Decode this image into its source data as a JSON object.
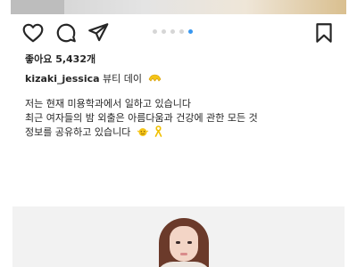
{
  "post": {
    "likes": "좋아요 5,432개",
    "caption_username": "kizaki_jessica",
    "caption_title": "뷰티 데이",
    "caption_lines": [
      "저는 현재 미용학과에서 일하고 있습니다",
      "최근 여자들의 밤 외출은 아름다움과 건강에 관한 모든 것",
      "정보를 공유하고 있습니다"
    ]
  },
  "carousel": {
    "total": 5,
    "active_index": 4
  },
  "icons": {
    "like": "heart-icon",
    "comment": "comment-icon",
    "share": "send-icon",
    "save": "bookmark-icon"
  },
  "colors": {
    "active_dot": "#3897f0",
    "text": "#262626"
  }
}
